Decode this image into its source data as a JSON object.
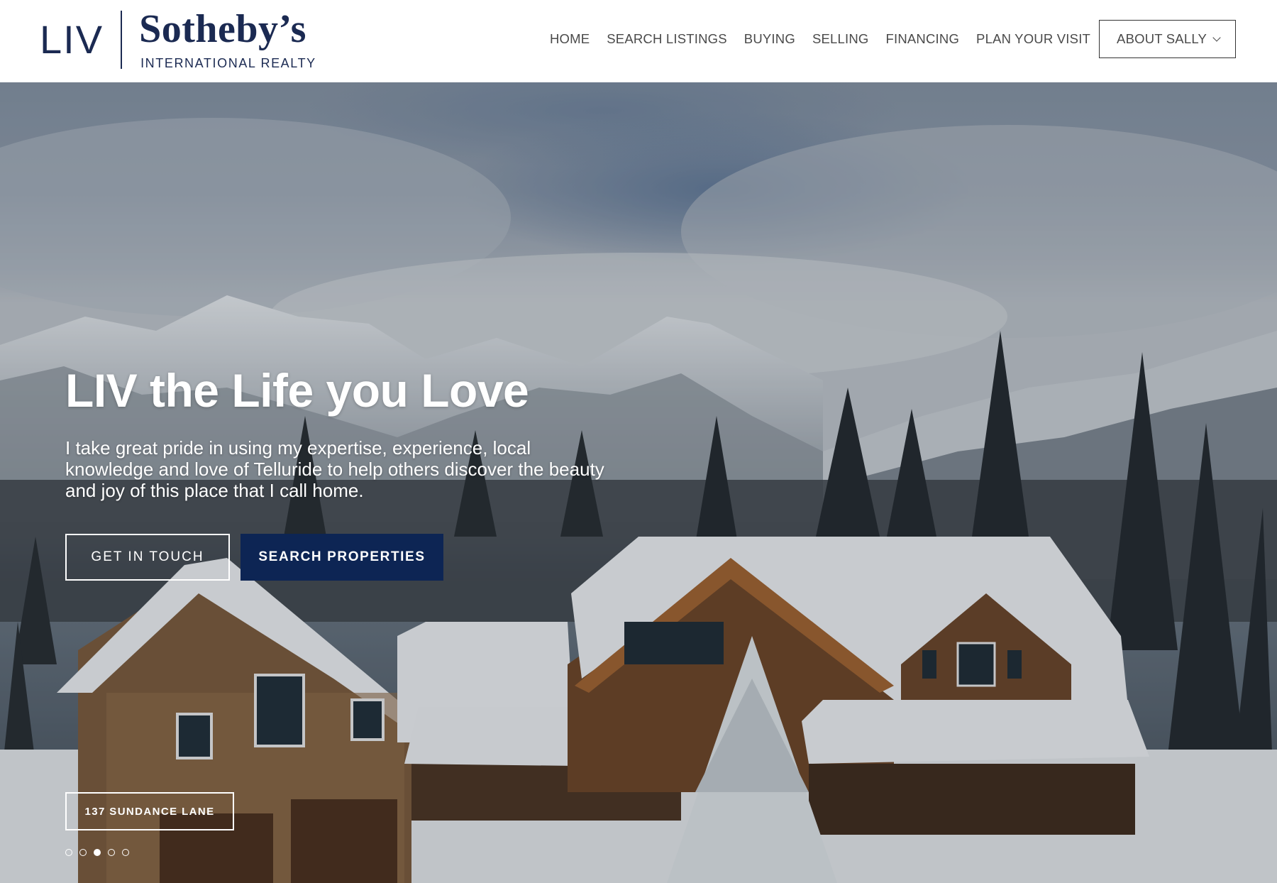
{
  "logo": {
    "liv": "LIV",
    "brand": "Sotheby’s",
    "subtitle": "INTERNATIONAL REALTY"
  },
  "nav": {
    "items": [
      {
        "label": "HOME"
      },
      {
        "label": "SEARCH LISTINGS"
      },
      {
        "label": "BUYING"
      },
      {
        "label": "SELLING"
      },
      {
        "label": "FINANCING"
      },
      {
        "label": "PLAN YOUR VISIT"
      }
    ],
    "dropdown_label": "ABOUT SALLY"
  },
  "hero": {
    "title": "LIV the Life you Love",
    "text": "I take great pride in using my expertise, experience, local knowledge and love of Telluride to help others discover the beauty and joy of this place that I call home.",
    "primary_button": "GET IN TOUCH",
    "secondary_button": "SEARCH PROPERTIES",
    "slide_caption": "137 SUNDANCE LANE",
    "slides": {
      "count": 5,
      "active_index": 2
    }
  },
  "colors": {
    "brand_navy": "#1b2a52",
    "button_navy": "#0d2554",
    "nav_text": "#4a4a4a"
  }
}
